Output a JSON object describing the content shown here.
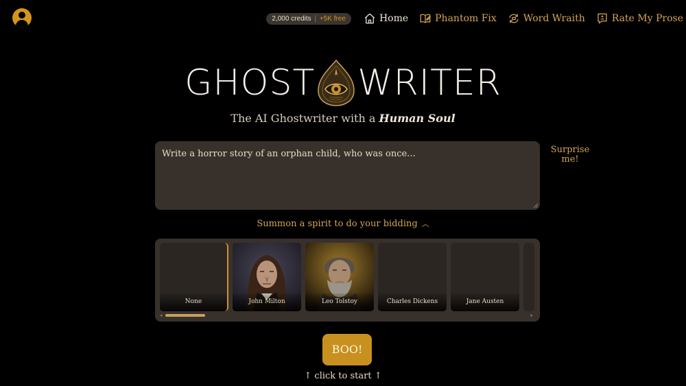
{
  "header": {
    "credits": "2,000 credits",
    "credits_sep": "|",
    "credits_free": "+5K free",
    "nav": [
      {
        "label": "Home",
        "icon": "home-icon"
      },
      {
        "label": "Phantom Fix",
        "icon": "book-edit-icon"
      },
      {
        "label": "Word Wraith",
        "icon": "rewrite-icon"
      },
      {
        "label": "Rate My Prose",
        "icon": "rating-icon"
      }
    ]
  },
  "logo": {
    "left": "GHOST",
    "right": "WRITER"
  },
  "tagline": {
    "prefix": "The AI Ghostwriter with a ",
    "emphasis": "Human Soul"
  },
  "prompt": {
    "value": "Write a horror story of an orphan child, who was once..."
  },
  "surprise_label": "Surprise me!",
  "summon_label": "Summon a spirit to do your bidding",
  "authors": [
    {
      "name": "None",
      "selected": true
    },
    {
      "name": "John Milton",
      "selected": false
    },
    {
      "name": "Leo Tolstoy",
      "selected": false
    },
    {
      "name": "Charles Dickens",
      "selected": false
    },
    {
      "name": "Jane Austen",
      "selected": false
    }
  ],
  "boo_label": "BOO!",
  "hint": "↑ click to start ↑",
  "colors": {
    "accent": "#d4951d",
    "panel": "#38312b",
    "text": "#e8dcc4",
    "background": "#000000"
  }
}
